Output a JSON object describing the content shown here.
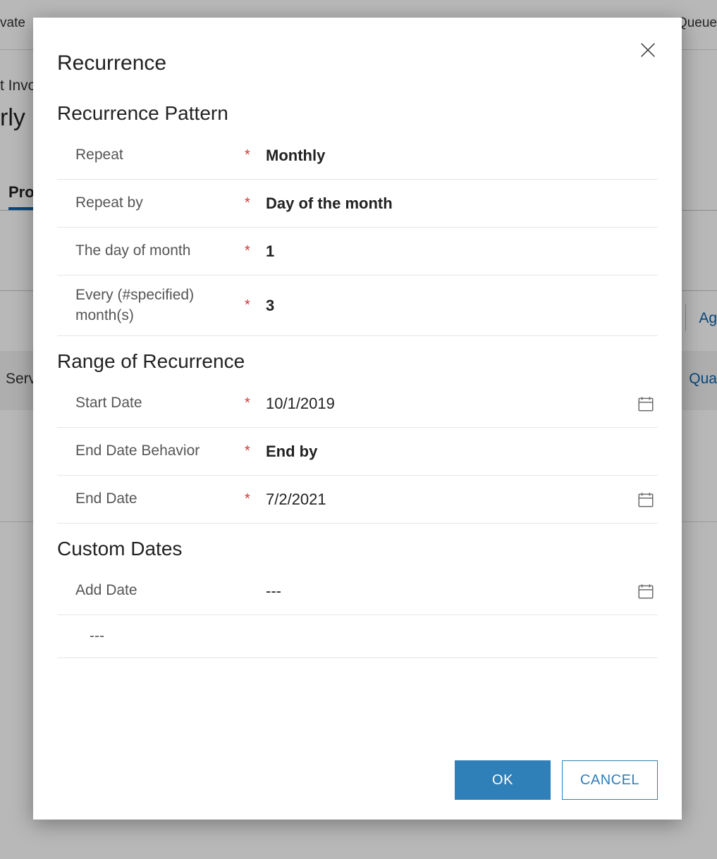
{
  "background": {
    "toolbar_left": "vate",
    "toolbar_right": "Queue",
    "breadcrumb": "t Invo",
    "title": "rly",
    "tab": "Pro",
    "link_right": "Ag",
    "row_left": "Serv",
    "row_right": "Qua"
  },
  "modal": {
    "title": "Recurrence",
    "sections": {
      "pattern": "Recurrence Pattern",
      "range": "Range of Recurrence",
      "custom": "Custom Dates"
    },
    "fields": {
      "repeat": {
        "label": "Repeat",
        "required": "*",
        "value": "Monthly"
      },
      "repeat_by": {
        "label": "Repeat by",
        "required": "*",
        "value": "Day of the month"
      },
      "day_of_month": {
        "label": "The day of month",
        "required": "*",
        "value": "1"
      },
      "every_months": {
        "label": "Every (#specified) month(s)",
        "required": "*",
        "value": "3"
      },
      "start_date": {
        "label": "Start Date",
        "required": "*",
        "value": "10/1/2019"
      },
      "end_behavior": {
        "label": "End Date Behavior",
        "required": "*",
        "value": "End by"
      },
      "end_date": {
        "label": "End Date",
        "required": "*",
        "value": "7/2/2021"
      },
      "add_date": {
        "label": "Add Date",
        "required": "",
        "value": "---"
      }
    },
    "custom_list_placeholder": "---",
    "buttons": {
      "ok": "OK",
      "cancel": "CANCEL"
    }
  }
}
